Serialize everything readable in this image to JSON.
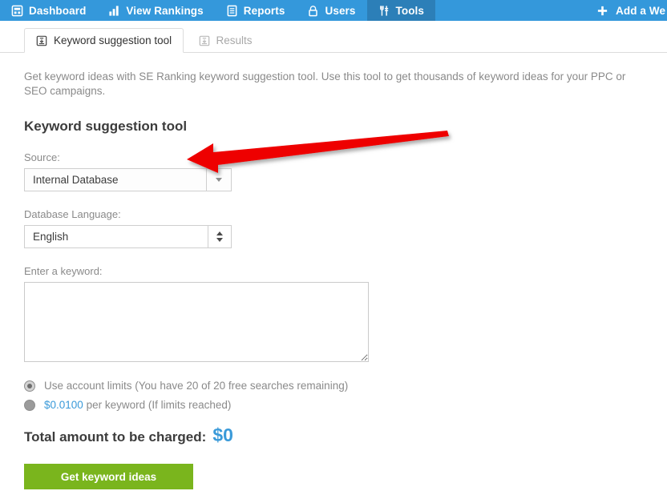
{
  "navbar": {
    "background": "#3498db",
    "active_background": "#2c7fb8",
    "items": [
      {
        "label": "Dashboard",
        "icon": "dashboard-icon",
        "active": false
      },
      {
        "label": "View Rankings",
        "icon": "bar-chart-icon",
        "active": false
      },
      {
        "label": "Reports",
        "icon": "document-icon",
        "active": false
      },
      {
        "label": "Users",
        "icon": "lock-icon",
        "active": false
      },
      {
        "label": "Tools",
        "icon": "tools-icon",
        "active": true
      }
    ],
    "right_action": {
      "label": "Add a We",
      "icon": "plus-icon"
    }
  },
  "tabs": [
    {
      "label": "Keyword suggestion tool",
      "icon": "save-box-icon",
      "active": true
    },
    {
      "label": "Results",
      "icon": "save-box-icon",
      "active": false
    }
  ],
  "intro": "Get keyword ideas with SE Ranking keyword suggestion tool. Use this tool to get thousands of keyword ideas for your PPC or SEO campaigns.",
  "page_title": "Keyword suggestion tool",
  "form": {
    "source": {
      "label": "Source:",
      "value": "Internal Database",
      "icon": "chevron-down-icon"
    },
    "database_language": {
      "label": "Database Language:",
      "value": "English",
      "icon": "stepper-updown-icon"
    },
    "keyword": {
      "label": "Enter a keyword:",
      "value": "",
      "placeholder": ""
    }
  },
  "pricing": {
    "options": [
      {
        "selected": true,
        "text": "Use account limits (You have 20 of 20 free searches remaining)",
        "price": ""
      },
      {
        "selected": false,
        "text": " per keyword (If limits reached)",
        "price": "$0.0100"
      }
    ],
    "total_label": "Total amount to be charged:",
    "total_value": "$0",
    "accent_color": "#3a9ad9"
  },
  "submit_button": {
    "label": "Get keyword ideas",
    "color": "#7ab51d"
  },
  "annotation": {
    "type": "arrow",
    "color": "#ee0000",
    "direction": "left",
    "points_to": "source-dropdown"
  }
}
